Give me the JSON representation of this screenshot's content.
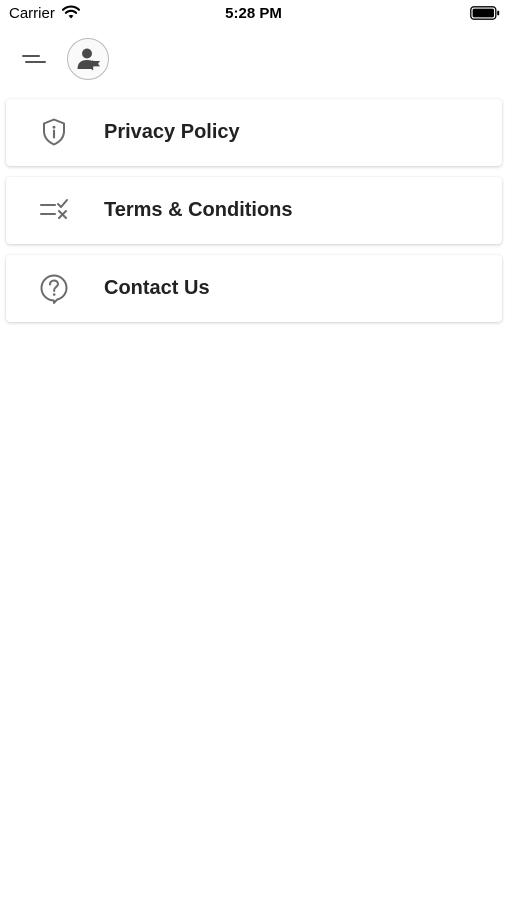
{
  "status_bar": {
    "carrier": "Carrier",
    "time": "5:28 PM",
    "wifi_icon": "wifi-icon",
    "battery_icon": "battery-full-icon"
  },
  "header": {
    "menu_icon": "hamburger-menu-icon",
    "avatar_icon": "user-flag-icon"
  },
  "menu": {
    "items": [
      {
        "label": "Privacy Policy",
        "icon": "shield-info-icon"
      },
      {
        "label": "Terms & Conditions",
        "icon": "checklist-icon"
      },
      {
        "label": "Contact Us",
        "icon": "help-bubble-icon"
      }
    ]
  },
  "colors": {
    "text": "#222222",
    "icon": "#6b6b6b",
    "background": "#ffffff"
  }
}
